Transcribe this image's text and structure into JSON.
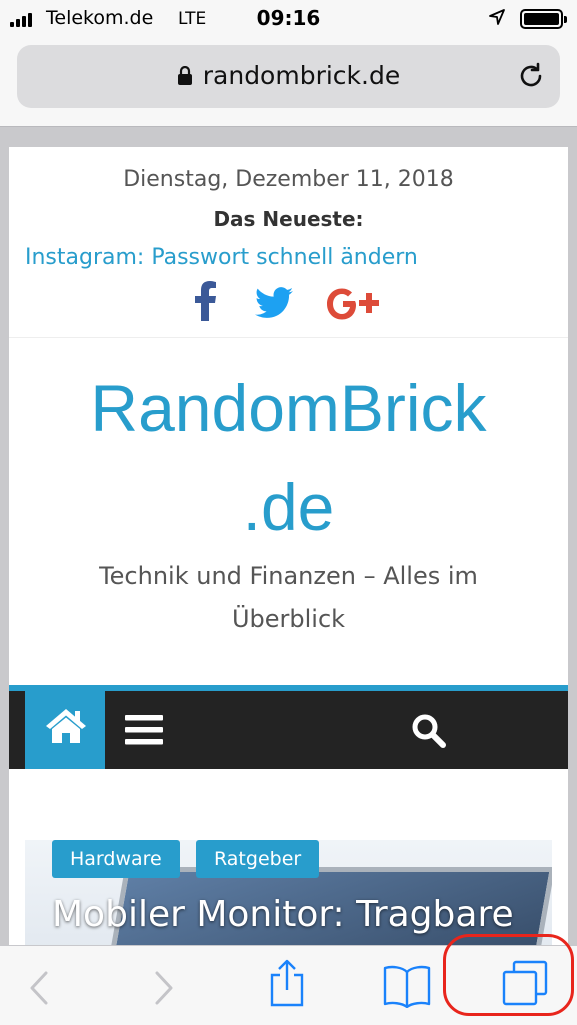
{
  "status_bar": {
    "carrier": "Telekom.de",
    "network": "LTE",
    "time": "09:16"
  },
  "address_bar": {
    "url": "randombrick.de"
  },
  "top_bar": {
    "date": "Dienstag, Dezember 11, 2018",
    "newest_label": "Das Neueste:",
    "newest_link": "Instagram: Passwort schnell ändern",
    "social": [
      "facebook-icon",
      "twitter-icon",
      "google-plus-icon"
    ]
  },
  "header": {
    "title_line1": "RandomBrick",
    "title_line2": ".de",
    "tagline": "Technik und Finanzen – Alles im Überblick"
  },
  "nav": {
    "items": [
      "home-icon",
      "menu-icon",
      "search-icon"
    ]
  },
  "featured": {
    "categories": [
      "Hardware",
      "Ratgeber"
    ],
    "title": "Mobiler Monitor: Tragbare"
  },
  "toolbar": {
    "items": [
      "back-icon",
      "forward-icon",
      "share-icon",
      "bookmarks-icon",
      "tabs-icon"
    ]
  },
  "colors": {
    "accent": "#289dcc",
    "nav_bg": "#232323",
    "facebook": "#3b5998",
    "twitter": "#1da1f2",
    "google_plus": "#dd4b39",
    "highlight": "#e8251c"
  }
}
